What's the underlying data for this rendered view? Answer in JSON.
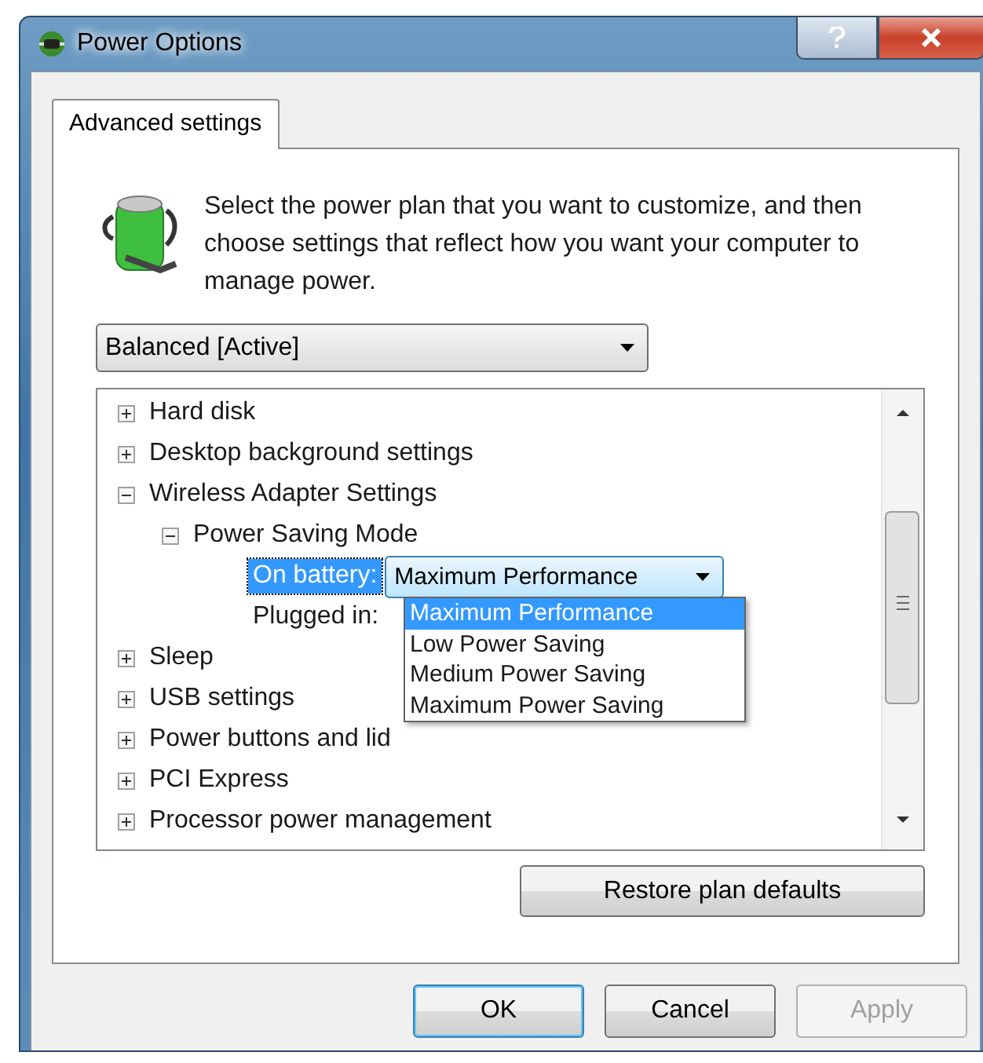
{
  "window": {
    "title": "Power Options"
  },
  "tabs": [
    {
      "label": "Advanced settings",
      "selected": true
    }
  ],
  "intro": "Select the power plan that you want to customize, and then choose settings that reflect how you want your computer to manage power.",
  "plan_select": {
    "value": "Balanced [Active]"
  },
  "tree": [
    {
      "kind": "group",
      "label": "Hard disk",
      "expanded": false
    },
    {
      "kind": "group",
      "label": "Desktop background settings",
      "expanded": false
    },
    {
      "kind": "group",
      "label": "Wireless Adapter Settings",
      "expanded": true,
      "children": [
        {
          "kind": "group",
          "label": "Power Saving Mode",
          "expanded": true,
          "children": [
            {
              "kind": "setting",
              "label": "On battery:",
              "selected": true,
              "value": "Maximum Performance",
              "dropdown_open": true,
              "options": [
                {
                  "label": "Maximum Performance",
                  "selected": true
                },
                {
                  "label": "Low Power Saving",
                  "selected": false
                },
                {
                  "label": "Medium Power Saving",
                  "selected": false
                },
                {
                  "label": "Maximum Power Saving",
                  "selected": false
                }
              ]
            },
            {
              "kind": "setting",
              "label": "Plugged in:",
              "selected": false
            }
          ]
        }
      ]
    },
    {
      "kind": "group",
      "label": "Sleep",
      "expanded": false
    },
    {
      "kind": "group",
      "label": "USB settings",
      "expanded": false
    },
    {
      "kind": "group",
      "label": "Power buttons and lid",
      "expanded": false
    },
    {
      "kind": "group",
      "label": "PCI Express",
      "expanded": false
    },
    {
      "kind": "group",
      "label": "Processor power management",
      "expanded": false
    }
  ],
  "restore_button": "Restore plan defaults",
  "buttons": [
    {
      "label": "OK",
      "default": true,
      "disabled": false
    },
    {
      "label": "Cancel",
      "default": false,
      "disabled": false
    },
    {
      "label": "Apply",
      "default": false,
      "disabled": true
    }
  ]
}
